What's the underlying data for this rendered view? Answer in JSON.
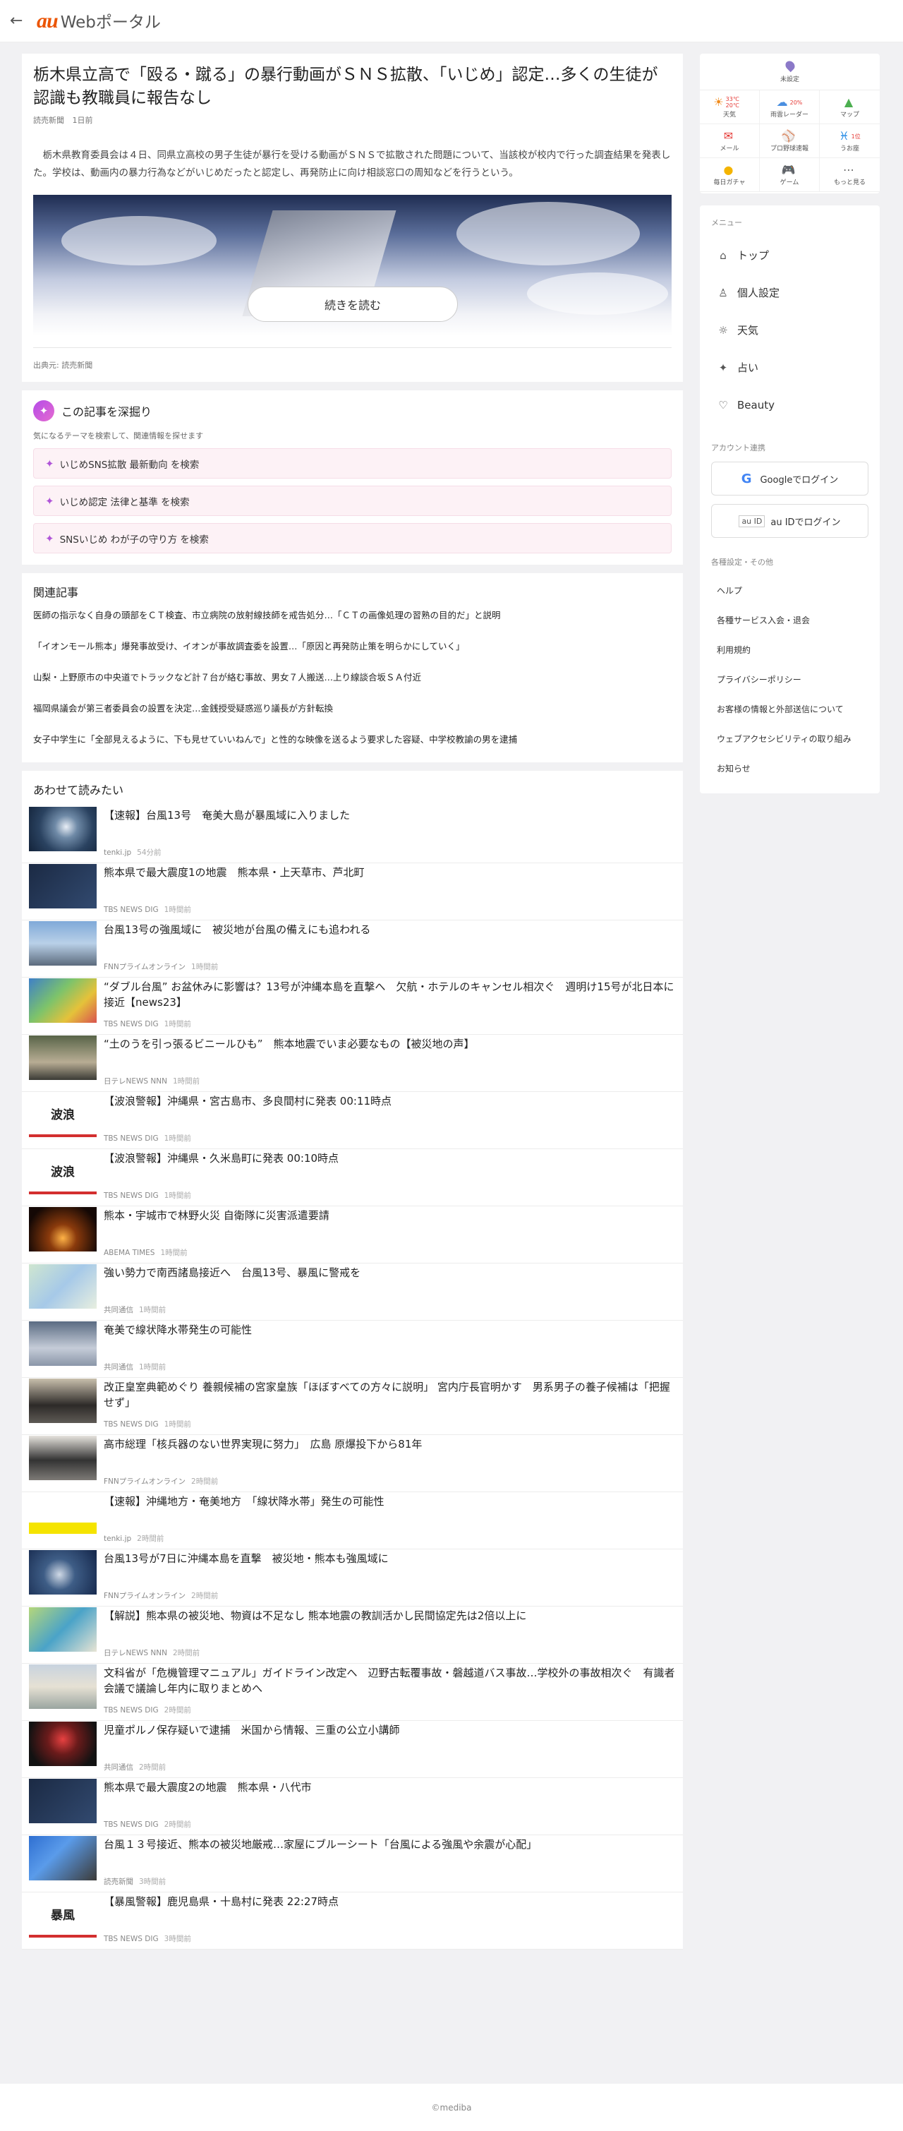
{
  "header": {
    "back_icon": "arrow-left-icon",
    "logo_au": "au",
    "logo_web": "Webポータル"
  },
  "article": {
    "title": "栃木県立高で「殴る・蹴る」の暴行動画がＳＮＳ拡散、「いじめ」認定…多くの生徒が認識も教職員に報告なし",
    "publisher": "読売新聞",
    "time": "1日前",
    "lead": "栃木県教育委員会は４日、同県立高校の男子生徒が暴行を受ける動画がＳＮＳで拡散された問題について、当該校が校内で行った調査結果を発表した。学校は、動画内の暴力行為などがいじめだったと認定し、再発防止に向け相談窓口の周知などを行うという。",
    "read_more": "続きを読む",
    "source": "出典元: 読売新聞"
  },
  "deep": {
    "title": "この記事を深掘り",
    "subtitle": "気になるテーマを検索して、関連情報を探せます",
    "chips": [
      "いじめSNS拡散 最新動向 を検索",
      "いじめ認定 法律と基準 を検索",
      "SNSいじめ わが子の守り方 を検索"
    ]
  },
  "related": {
    "title": "関連記事",
    "items": [
      "医師の指示なく自身の頭部をＣＴ検査、市立病院の放射線技師を戒告処分…「ＣＴの画像処理の習熟の目的だ」と説明",
      "「イオンモール熊本」爆発事故受け、イオンが事故調査委を設置…「原因と再発防止策を明らかにしていく」",
      "山梨・上野原市の中央道でトラックなど計７台が絡む事故、男女７人搬送…上り線談合坂ＳＡ付近",
      "福岡県議会が第三者委員会の設置を決定…金銭授受疑惑巡り議長が方針転換",
      "女子中学生に「全部見えるように、下も見せていいねんで」と性的な映像を送るよう要求した容疑、中学校教諭の男を逮捕"
    ]
  },
  "also": {
    "title": "あわせて読みたい",
    "items": [
      {
        "title": "【速報】台風13号　奄美大島が暴風域に入りました",
        "source": "tenki.jp",
        "time": "54分前",
        "thumb": "satellite"
      },
      {
        "title": "熊本県で最大震度1の地震　熊本県・上天草市、芦北町",
        "source": "TBS NEWS DIG",
        "time": "1時間前",
        "thumb": "map"
      },
      {
        "title": "台風13号の強風域に　被災地が台風の備えにも追われる",
        "source": "FNNプライムオンライン",
        "time": "1時間前",
        "thumb": "roof"
      },
      {
        "title": "“ダブル台風” お盆休みに影響は？13号が沖縄本島を直撃へ　欠航・ホテルのキャンセル相次ぐ　週明け15号が北日本に接近【news23】",
        "source": "TBS NEWS DIG",
        "time": "1時間前",
        "thumb": "weathermap"
      },
      {
        "title": "“土のうを引っ張るビニールひも”　熊本地震でいま必要なもの【被災地の声】",
        "source": "日テレNEWS NNN",
        "time": "1時間前",
        "thumb": "person"
      },
      {
        "title": "【波浪警報】沖縄県・宮古島市、多良間村に発表 00:11時点",
        "source": "TBS NEWS DIG",
        "time": "1時間前",
        "thumb": "badge",
        "badge": "波浪"
      },
      {
        "title": "【波浪警報】沖縄県・久米島町に発表 00:10時点",
        "source": "TBS NEWS DIG",
        "time": "1時間前",
        "thumb": "badge",
        "badge": "波浪"
      },
      {
        "title": "熊本・宇城市で林野火災 自衛隊に災害派遣要請",
        "source": "ABEMA TIMES",
        "time": "1時間前",
        "thumb": "fire"
      },
      {
        "title": "強い勢力で南西諸島接近へ　台風13号、暴風に警戒を",
        "source": "共同通信",
        "time": "1時間前",
        "thumb": "track"
      },
      {
        "title": "奄美で線状降水帯発生の可能性",
        "source": "共同通信",
        "time": "1時間前",
        "thumb": "portal"
      },
      {
        "title": "改正皇室典範めぐり 養親候補の宮家皇族「ほぼすべての方々に説明」 宮内庁長官明かす　男系男子の養子候補は「把握せず」",
        "source": "TBS NEWS DIG",
        "time": "1時間前",
        "thumb": "person2"
      },
      {
        "title": "高市総理「核兵器のない世界実現に努力」　広島 原爆投下から81年",
        "source": "FNNプライムオンライン",
        "time": "2時間前",
        "thumb": "person3"
      },
      {
        "title": "【速報】沖縄地方・奄美地方　「線状降水帯」発生の可能性",
        "source": "tenki.jp",
        "time": "2時間前",
        "thumb": "notice"
      },
      {
        "title": "台風13号が7日に沖縄本島を直撃　被災地・熊本も強風域に",
        "source": "FNNプライムオンライン",
        "time": "2時間前",
        "thumb": "satellite2"
      },
      {
        "title": "【解説】熊本県の被災地、物資は不足なし 熊本地震の教訓活かし民間協定先は2倍以上に",
        "source": "日テレNEWS NNN",
        "time": "2時間前",
        "thumb": "panel"
      },
      {
        "title": "文科省が「危機管理マニュアル」ガイドライン改定へ　辺野古転覆事故・磐越道バス事故…学校外の事故相次ぐ　有識者会議で議論し年内に取りまとめへ",
        "source": "TBS NEWS DIG",
        "time": "2時間前",
        "thumb": "building"
      },
      {
        "title": "児童ポルノ保存疑いで逮捕　米国から情報、三重の公立小講師",
        "source": "共同通信",
        "time": "2時間前",
        "thumb": "police"
      },
      {
        "title": "熊本県で最大震度2の地震　熊本県・八代市",
        "source": "TBS NEWS DIG",
        "time": "2時間前",
        "thumb": "map"
      },
      {
        "title": "台風１３号接近、熊本の被災地厳戒…家屋にブルーシート「台風による強風や余震が心配」",
        "source": "読売新聞",
        "time": "3時間前",
        "thumb": "tarp"
      },
      {
        "title": "【暴風警報】鹿児島県・十島村に発表 22:27時点",
        "source": "TBS NEWS DIG",
        "time": "3時間前",
        "thumb": "badge",
        "badge": "暴風"
      }
    ]
  },
  "side": {
    "location": "未設定",
    "tiles": [
      {
        "label": "天気",
        "icon": "sun-icon",
        "glyph": "☀",
        "extra": "33℃ 20℃",
        "color": "#f08a1a"
      },
      {
        "label": "雨雲レーダー",
        "icon": "cloud-icon",
        "glyph": "☁",
        "extra": "20%",
        "color": "#4a8fe0"
      },
      {
        "label": "マップ",
        "icon": "map-icon",
        "glyph": "▲",
        "extra": "",
        "color": "#4caf50"
      },
      {
        "label": "メール",
        "icon": "mail-icon",
        "glyph": "✉",
        "extra": "",
        "color": "#e53935"
      },
      {
        "label": "プロ野球速報",
        "icon": "bat-icon",
        "glyph": "⚾",
        "extra": "",
        "color": "#e65100"
      },
      {
        "label": "うお座",
        "icon": "fish-icon",
        "glyph": "♓",
        "extra": "1位",
        "color": "#1e88e5"
      },
      {
        "label": "毎日ガチャ",
        "icon": "gacha-icon",
        "glyph": "●",
        "extra": "",
        "color": "#f4b400"
      },
      {
        "label": "ゲーム",
        "icon": "gamepad-icon",
        "glyph": "🎮",
        "extra": "",
        "color": "#29b6f6"
      },
      {
        "label": "もっと見る",
        "icon": "more-icon",
        "glyph": "⋯",
        "extra": "",
        "color": "#666"
      }
    ],
    "menu_header": "メニュー",
    "menu": [
      {
        "label": "トップ",
        "icon": "home-icon",
        "glyph": "⌂"
      },
      {
        "label": "個人設定",
        "icon": "user-icon",
        "glyph": "♙"
      },
      {
        "label": "天気",
        "icon": "sun-outline-icon",
        "glyph": "☼"
      },
      {
        "label": "占い",
        "icon": "sparkle-icon",
        "glyph": "✦"
      },
      {
        "label": "Beauty",
        "icon": "heart-icon",
        "glyph": "♡"
      }
    ],
    "account_header": "アカウント連携",
    "google_login": "Googleでログイン",
    "auid_login": "au IDでログイン",
    "auid_alt": "au ID",
    "settings_header": "各種設定・その他",
    "links": [
      "ヘルプ",
      "各種サービス入会・退会",
      "利用規約",
      "プライバシーポリシー",
      "お客様の情報と外部送信について",
      "ウェブアクセシビリティの取り組み",
      "お知らせ"
    ]
  },
  "footer": {
    "copyright": "©mediba"
  }
}
